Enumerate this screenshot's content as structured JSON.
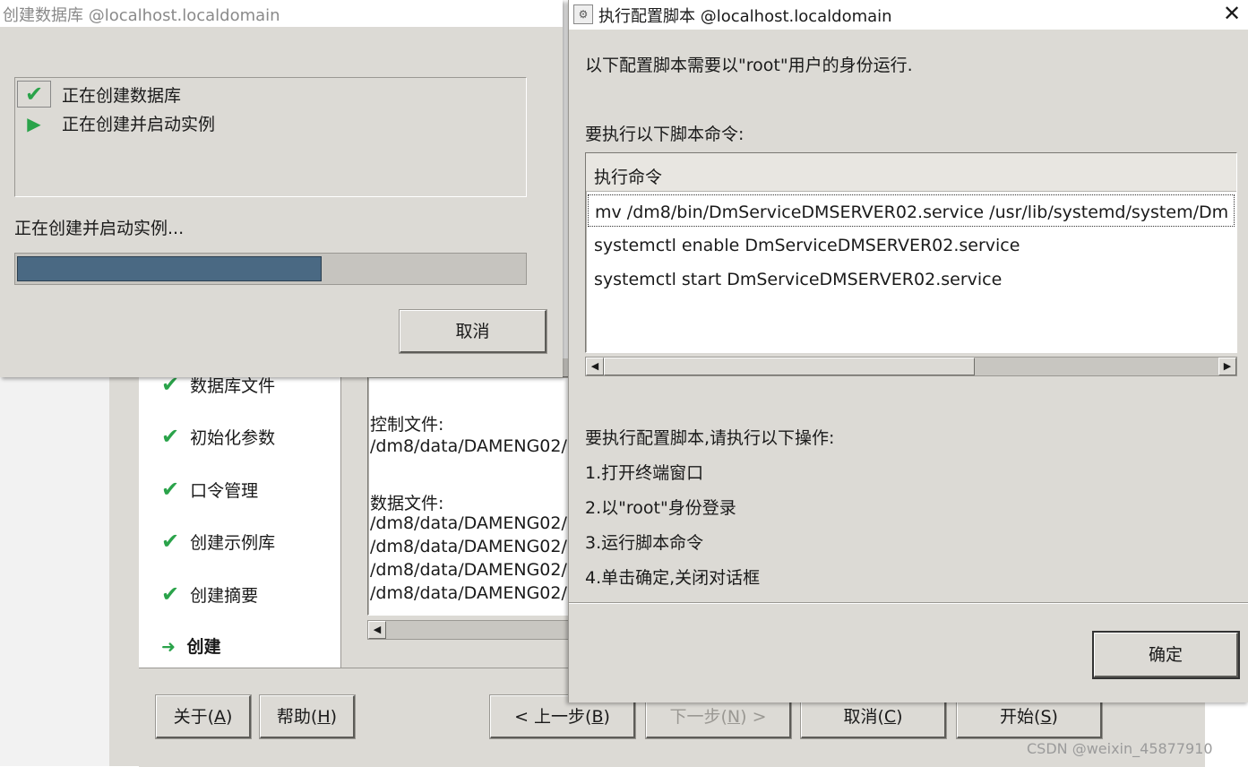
{
  "bg_window": {
    "nav_items": [
      {
        "icon": "check-icon",
        "label": "数据库文件"
      },
      {
        "icon": "check-icon",
        "label": "初始化参数"
      },
      {
        "icon": "check-icon",
        "label": "口令管理"
      },
      {
        "icon": "check-icon",
        "label": "创建示例库"
      },
      {
        "icon": "check-icon",
        "label": "创建摘要"
      },
      {
        "icon": "arrow-right-icon",
        "label": "创建"
      }
    ],
    "summary": {
      "control_label": "控制文件:",
      "control_path": "/dm8/data/DAMENG02/",
      "data_label": "数据文件:",
      "data_paths": [
        "/dm8/data/DAMENG02/",
        "/dm8/data/DAMENG02/",
        "/dm8/data/DAMENG02/",
        "/dm8/data/DAMENG02/"
      ]
    },
    "buttons": {
      "about": {
        "text": "关于(",
        "key": "A",
        "end": ")"
      },
      "help": {
        "text": "帮助(",
        "key": "H",
        "end": ")"
      },
      "prev": {
        "text": "< 上一步(",
        "key": "B",
        "end": ")"
      },
      "next": {
        "text": "下一步(",
        "key": "N",
        "end": ") >"
      },
      "cancel": {
        "text": "取消(",
        "key": "C",
        "end": ")"
      },
      "start": {
        "text": "开始(",
        "key": "S",
        "end": ")"
      }
    }
  },
  "create_db_window": {
    "title": "创建数据库 @localhost.localdomain",
    "steps": [
      {
        "icon": "check-icon",
        "label": "正在创建数据库"
      },
      {
        "icon": "play-icon",
        "label": "正在创建并启动实例"
      }
    ],
    "status_text": "正在创建并启动实例...",
    "progress": 0.6,
    "cancel_label": "取消"
  },
  "script_window": {
    "title": "执行配置脚本 @localhost.localdomain",
    "intro": "以下配置脚本需要以\"root\"用户的身份运行.",
    "commands_label": "要执行以下脚本命令:",
    "table_header": "执行命令",
    "commands": [
      "mv /dm8/bin/DmServiceDMSERVER02.service /usr/lib/systemd/system/Dm",
      "systemctl enable DmServiceDMSERVER02.service",
      "systemctl start DmServiceDMSERVER02.service"
    ],
    "instructions_title": "要执行配置脚本,请执行以下操作:",
    "instructions": [
      "1.打开终端窗口",
      "2.以\"root\"身份登录",
      "3.运行脚本命令",
      "4.单击确定,关闭对话框"
    ],
    "ok_label": "确定"
  },
  "watermark": "CSDN @weixin_45877910"
}
